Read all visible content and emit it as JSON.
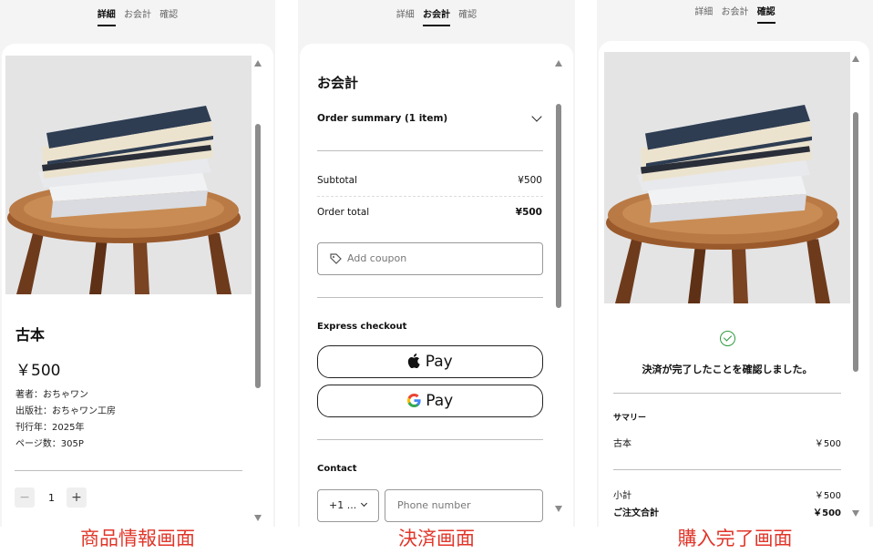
{
  "tabs": [
    "詳細",
    "お会計",
    "確認"
  ],
  "product_page": {
    "active_tab": 0,
    "title": "古本",
    "price": "￥500",
    "meta": [
      "著者：おちゃワン",
      "出版社：おちゃワン工房",
      "刊行年：2025年",
      "ページ数：305P"
    ],
    "qty_minus": "−",
    "qty_value": "1",
    "qty_plus": "+",
    "caption": "商品情報画面"
  },
  "checkout_page": {
    "active_tab": 1,
    "title": "お会計",
    "order_summary": "Order summary (1 item)",
    "subtotal_label": "Subtotal",
    "subtotal_value": "¥500",
    "order_total_label": "Order total",
    "order_total_value": "¥500",
    "coupon_placeholder": "Add coupon",
    "express_checkout": "Express checkout",
    "apple_pay": " Pay",
    "google_pay": "Pay",
    "contact_label": "Contact",
    "country_code": "+1 ...",
    "phone_placeholder": "Phone number",
    "caption": "決済画面"
  },
  "confirm_page": {
    "active_tab": 2,
    "message": "決済が完了したことを確認しました。",
    "summary_label": "サマリー",
    "item_name": "古本",
    "item_price": "￥500",
    "subtotal_label": "小計",
    "subtotal_value": "￥500",
    "total_label": "ご注文合計",
    "total_value": "￥500",
    "caption": "購入完了画面"
  },
  "colors": {
    "caption": "#e0362a",
    "check": "#2e9b3f",
    "scrollbar": "#8c8c8c"
  },
  "icons": [
    "scroll-up-icon",
    "scroll-down-icon",
    "chevron-down-icon",
    "tag-icon",
    "apple-icon",
    "google-g-icon",
    "check-circle-icon"
  ]
}
